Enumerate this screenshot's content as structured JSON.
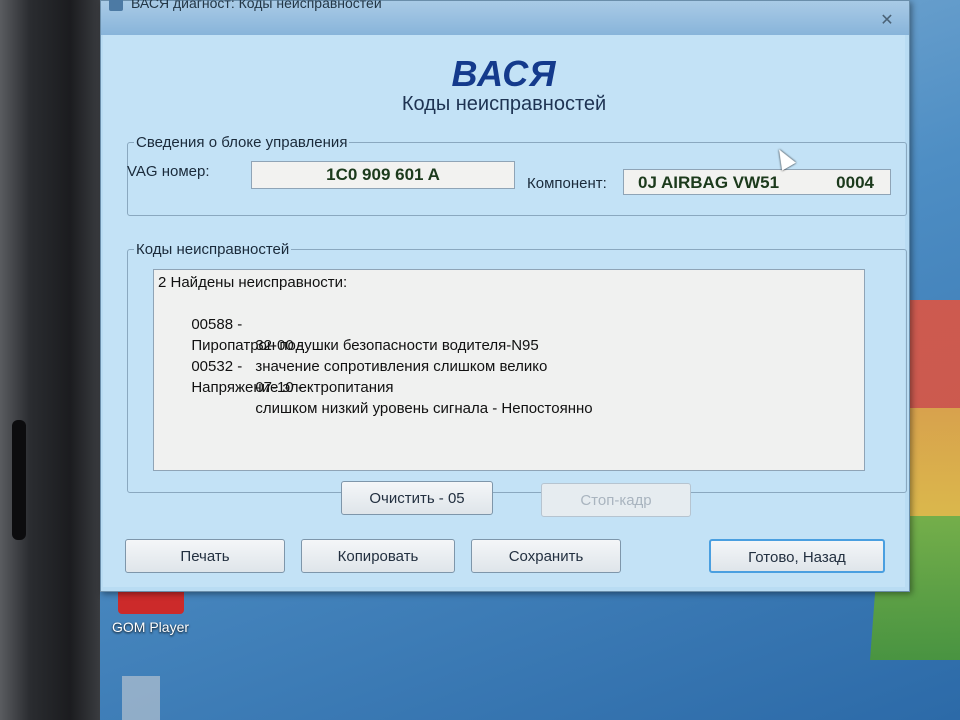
{
  "window": {
    "title": "ВАСЯ диагност: Коды неисправностей"
  },
  "header": {
    "app_name": "ВАСЯ",
    "subtitle": "Коды неисправностей"
  },
  "ecu_info": {
    "group_label": "Сведения о блоке управления",
    "vag_label": "VAG номер:",
    "vag_value": "1C0 909 601 A",
    "component_label": "Компонент:",
    "component_value": "0J AIRBAG VW51",
    "component_number": "0004"
  },
  "fault_codes": {
    "group_label": "Коды неисправностей",
    "summary": "2 Найдены неисправности:",
    "faults": [
      {
        "code": "00588 -",
        "description": "Пиропатрон подушки безопасности водителя-N95",
        "subcode": "32-00 -",
        "subdescription": "значение сопротивления слишком велико"
      },
      {
        "code": "00532 -",
        "description": "Напряжение электропитания",
        "subcode": "07-10 -",
        "subdescription": "слишком низкий уровень сигнала - Непостоянно"
      }
    ]
  },
  "buttons": {
    "clear": "Очистить - 05",
    "freeze_frame": "Стоп-кадр",
    "print": "Печать",
    "copy": "Копировать",
    "save": "Сохранить",
    "done_back": "Готово, Назад"
  },
  "desktop": {
    "icon_label": "GOM Player"
  },
  "colors": {
    "window_bg": "#c3e2f6",
    "title_accent": "#143a8c",
    "default_button_border": "#4a9fe0"
  }
}
